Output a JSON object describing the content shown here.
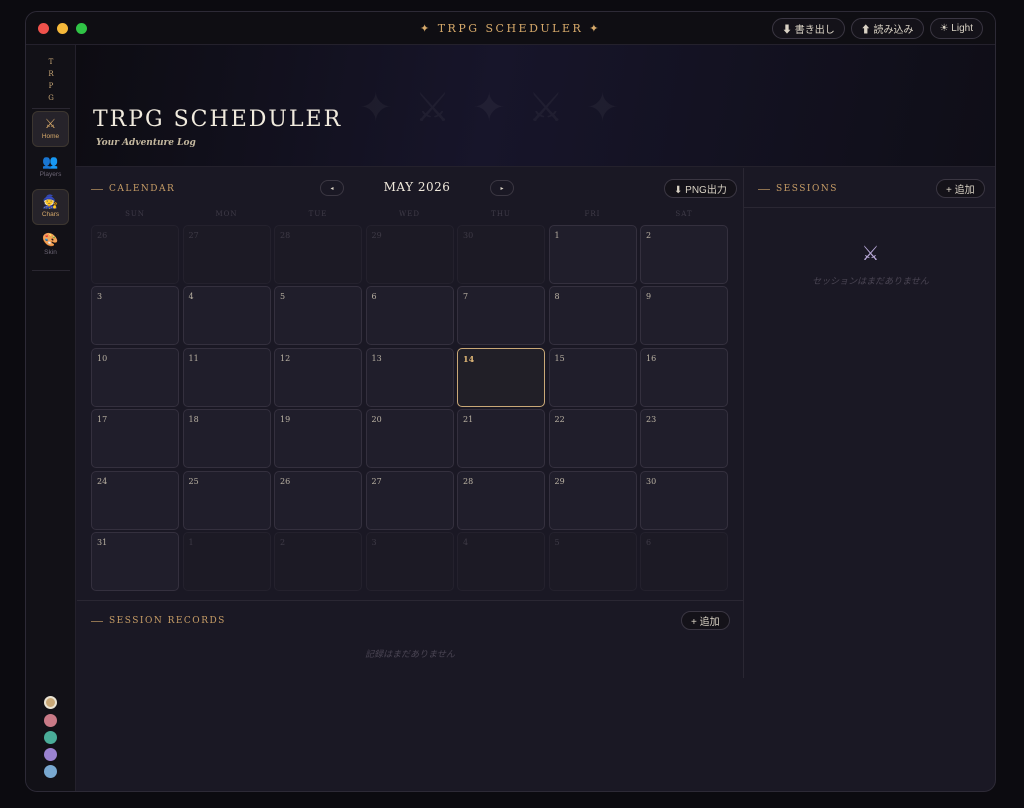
{
  "window": {
    "title": "✦ TRPG SCHEDULER ✦",
    "export_label": "⬇ 書き出し",
    "import_label": "⬆ 読み込み",
    "theme_label": "☀ Light"
  },
  "sidebar": {
    "logo_letters": [
      "T",
      "R",
      "P",
      "G"
    ],
    "items": [
      {
        "label": "Home",
        "icon": "crossed-swords-icon",
        "glyph": "⚔",
        "active": true
      },
      {
        "label": "Players",
        "icon": "people-icon",
        "glyph": "👥",
        "active": false
      },
      {
        "label": "Chars",
        "icon": "mage-icon",
        "glyph": "🧙",
        "active": true
      },
      {
        "label": "Skin",
        "icon": "palette-icon",
        "glyph": "🎨",
        "active": false
      }
    ],
    "swatches": [
      "#c9a877",
      "#c97a87",
      "#4aad99",
      "#9a82d0",
      "#78a8d0"
    ]
  },
  "hero": {
    "title": "TRPG SCHEDULER",
    "subtitle": "Your Adventure Log",
    "decor": "✦⚔✦⚔✦"
  },
  "calendar": {
    "heading": "CALENDAR",
    "prev_label": "◂",
    "next_label": "▸",
    "month": "MAY 2026",
    "export_png_label": "⬇ PNG出力",
    "weekdays": [
      "SUN",
      "MON",
      "TUE",
      "WED",
      "THU",
      "FRI",
      "SAT"
    ],
    "today": 14,
    "days": [
      {
        "n": "26",
        "out": true
      },
      {
        "n": "27",
        "out": true
      },
      {
        "n": "28",
        "out": true
      },
      {
        "n": "29",
        "out": true
      },
      {
        "n": "30",
        "out": true
      },
      {
        "n": "1"
      },
      {
        "n": "2"
      },
      {
        "n": "3"
      },
      {
        "n": "4"
      },
      {
        "n": "5"
      },
      {
        "n": "6"
      },
      {
        "n": "7"
      },
      {
        "n": "8"
      },
      {
        "n": "9"
      },
      {
        "n": "10"
      },
      {
        "n": "11"
      },
      {
        "n": "12"
      },
      {
        "n": "13"
      },
      {
        "n": "14",
        "today": true
      },
      {
        "n": "15"
      },
      {
        "n": "16"
      },
      {
        "n": "17"
      },
      {
        "n": "18"
      },
      {
        "n": "19"
      },
      {
        "n": "20"
      },
      {
        "n": "21"
      },
      {
        "n": "22"
      },
      {
        "n": "23"
      },
      {
        "n": "24"
      },
      {
        "n": "25"
      },
      {
        "n": "26"
      },
      {
        "n": "27"
      },
      {
        "n": "28"
      },
      {
        "n": "29"
      },
      {
        "n": "30"
      },
      {
        "n": "31"
      },
      {
        "n": "1",
        "out": true
      },
      {
        "n": "2",
        "out": true
      },
      {
        "n": "3",
        "out": true
      },
      {
        "n": "4",
        "out": true
      },
      {
        "n": "5",
        "out": true
      },
      {
        "n": "6",
        "out": true
      }
    ]
  },
  "sessions": {
    "heading": "SESSIONS",
    "add_label": "+ 追加",
    "empty_icon": "⚔",
    "empty_text": "セッションはまだありません"
  },
  "records": {
    "heading": "SESSION RECORDS",
    "add_label": "+ 追加",
    "empty_text": "記録はまだありません"
  }
}
